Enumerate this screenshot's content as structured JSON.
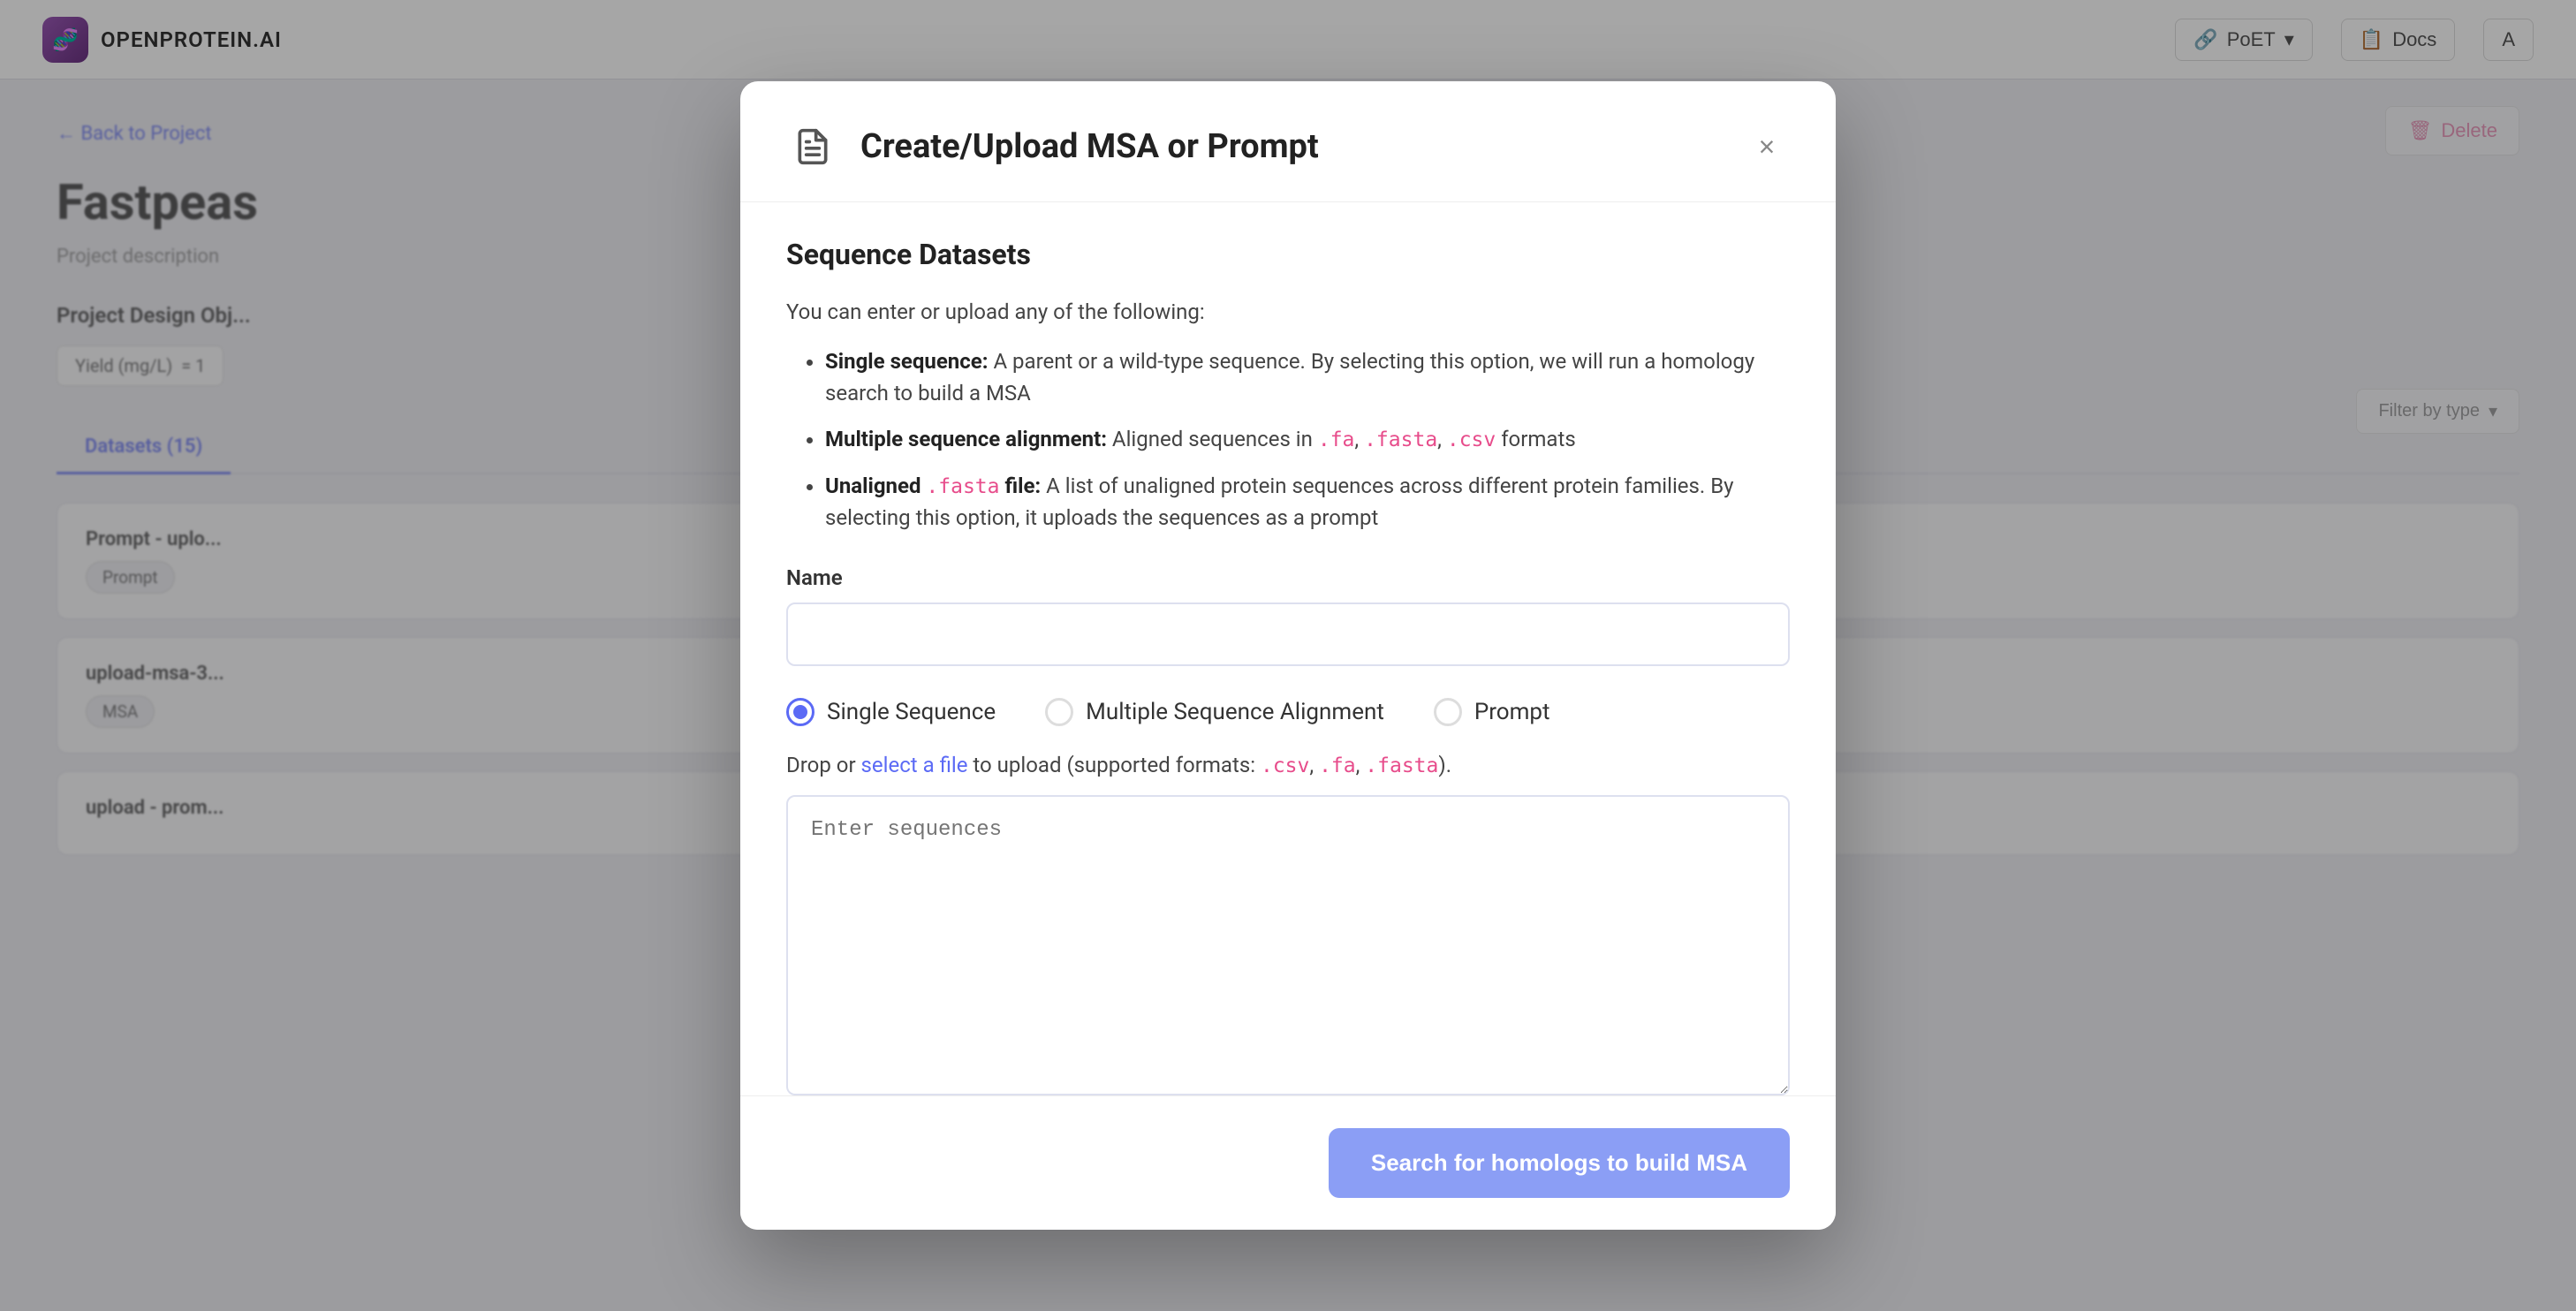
{
  "app": {
    "name": "OPENPROTEIN.AI",
    "logo_emoji": "🧬"
  },
  "nav": {
    "poet_label": "PoET",
    "docs_label": "Docs",
    "user_label": "A"
  },
  "page": {
    "back_link": "← Back to Project",
    "title": "Fastpeas",
    "description": "Project description",
    "design_objectives_label": "Project Design Obj...",
    "yield_label": "Yield (mg/L)",
    "yield_value": "= 1",
    "datasets_tab": "Datasets (15)",
    "delete_label": "Delete",
    "filter_label": "Filter by type",
    "items": [
      {
        "title": "Prompt - uplo...",
        "badge": "Prompt"
      },
      {
        "title": "upload-msa-3...",
        "badge": "MSA"
      },
      {
        "title": "upload - prom...",
        "badge": ""
      }
    ]
  },
  "modal": {
    "title": "Create/Upload MSA or Prompt",
    "icon": "📄",
    "close_label": "×",
    "section_heading": "Sequence Datasets",
    "description": "You can enter or upload any of the following:",
    "bullets": [
      {
        "bold": "Single sequence:",
        "text": " A parent or a wild-type sequence. By selecting this option, we will run a homology search to build a MSA"
      },
      {
        "bold": "Multiple sequence alignment:",
        "text": " Aligned sequences in ",
        "codes": [
          ".fa",
          ".fasta",
          ".csv"
        ],
        "suffix": " formats"
      },
      {
        "bold": "Unaligned",
        "code": ".fasta",
        "bold2": " file:",
        "text": " A list of unaligned protein sequences across different protein families. By selecting this option, it uploads the sequences as a prompt"
      }
    ],
    "name_label": "Name",
    "name_placeholder": "",
    "radio_options": [
      {
        "id": "single",
        "label": "Single Sequence",
        "selected": true
      },
      {
        "id": "multiple",
        "label": "Multiple Sequence Alignment",
        "selected": false
      },
      {
        "id": "prompt",
        "label": "Prompt",
        "selected": false
      }
    ],
    "upload_text_pre": "Drop or ",
    "upload_link": "select a file",
    "upload_text_post": " to upload (supported formats: ",
    "upload_formats": [
      ".csv",
      ".fa",
      ".fasta"
    ],
    "upload_suffix": ").",
    "sequence_placeholder": "Enter sequences",
    "submit_label": "Search for homologs to build MSA"
  }
}
